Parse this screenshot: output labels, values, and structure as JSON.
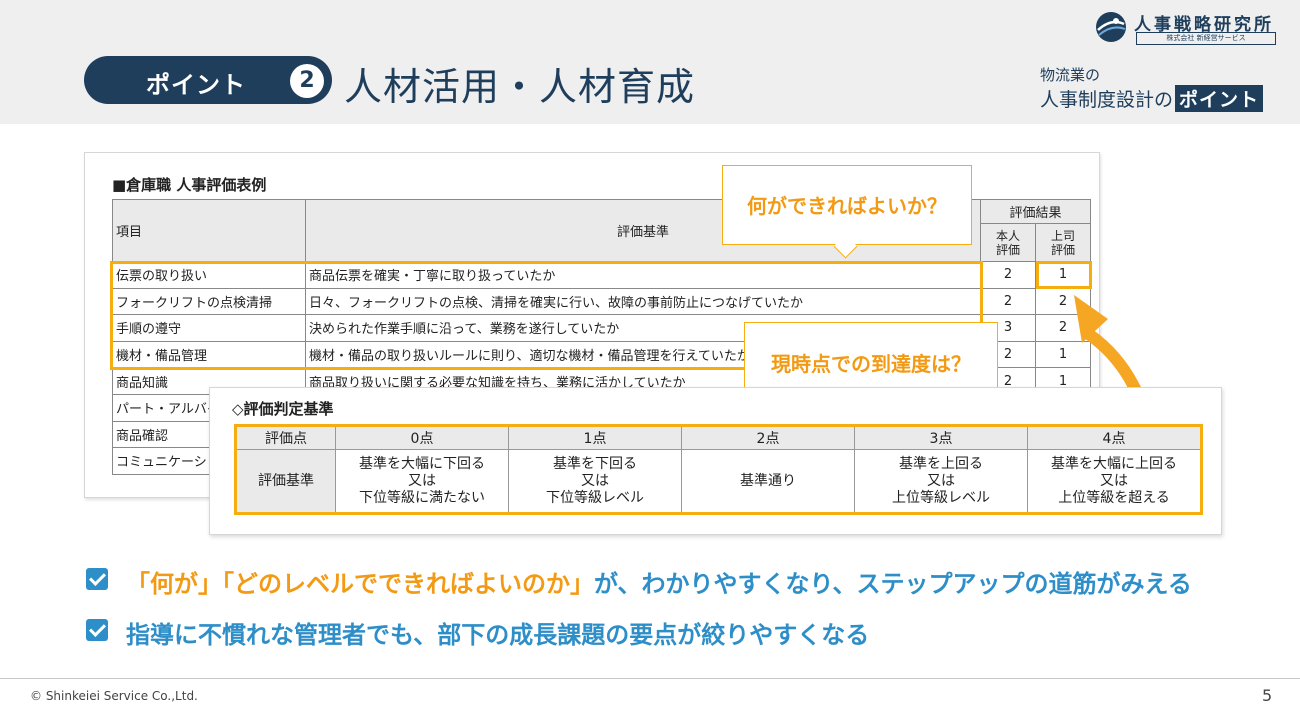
{
  "header": {
    "pill_label": "ポイント",
    "point_number": "2",
    "title": "人材活用・人材育成",
    "logo_name": "人事戦略研究所",
    "logo_sub": "株式会社 新経営サービス",
    "series_top": "物流業の",
    "series_bottom": "人事制度設計の",
    "series_badge": "ポイント"
  },
  "card": {
    "title": "■倉庫職 人事評価表例",
    "header_item": "項目",
    "header_criteria": "評価基準",
    "header_result": "評価結果",
    "header_self": "本人\n評価",
    "header_boss": "上司\n評価",
    "rows": [
      {
        "item": "伝票の取り扱い",
        "criteria": "商品伝票を確実・丁寧に取り扱っていたか",
        "self": "2",
        "boss": "1"
      },
      {
        "item": "フォークリフトの点検清掃",
        "criteria": "日々、フォークリフトの点検、清掃を確実に行い、故障の事前防止につなげていたか",
        "self": "2",
        "boss": "2"
      },
      {
        "item": "手順の遵守",
        "criteria": "決められた作業手順に沿って、業務を遂行していたか",
        "self": "3",
        "boss": "2"
      },
      {
        "item": "機材・備品管理",
        "criteria": "機材・備品の取り扱いルールに則り、適切な機材・備品管理を行えていたか",
        "self": "2",
        "boss": "1"
      },
      {
        "item": "商品知識",
        "criteria": "商品取り扱いに関する必要な知識を持ち、業務に活かしていたか",
        "self": "2",
        "boss": "1"
      },
      {
        "item": "パート・アルバイト",
        "criteria": "",
        "self": "",
        "boss": ""
      },
      {
        "item": "商品確認",
        "criteria": "",
        "self": "",
        "boss": ""
      },
      {
        "item": "コミュニケーション",
        "criteria": "",
        "self": "",
        "boss": ""
      }
    ]
  },
  "callouts": {
    "what": "何ができればよいか？",
    "level": "現時点での到達度は？"
  },
  "criteria_card": {
    "title": "◇評価判定基準",
    "col_label": "評価点",
    "row_label": "評価基準",
    "points": [
      "0点",
      "1点",
      "2点",
      "3点",
      "4点"
    ],
    "descriptions": [
      "基準を大幅に下回る\n又は\n下位等級に満たない",
      "基準を下回る\n又は\n下位等級レベル",
      "基準通り",
      "基準を上回る\n又は\n上位等級レベル",
      "基準を大幅に上回る\n又は\n上位等級を超える"
    ]
  },
  "bullets": {
    "b1_orange": "「何が」「どのレベルでできればよいのか」",
    "b1_rest": "が、わかりやすくなり、ステップアップの道筋がみえる",
    "b2": "指導に不慣れな管理者でも、部下の成長課題の要点が絞りやすくなる"
  },
  "footer": {
    "copyright": "© Shinkeiei Service Co.,Ltd.",
    "page": "5"
  },
  "colors": {
    "navy": "#1e3e5c",
    "accent_orange": "#f39a14",
    "highlight_yellow": "#f5ad0f",
    "bullet_blue": "#2e8ec8"
  }
}
